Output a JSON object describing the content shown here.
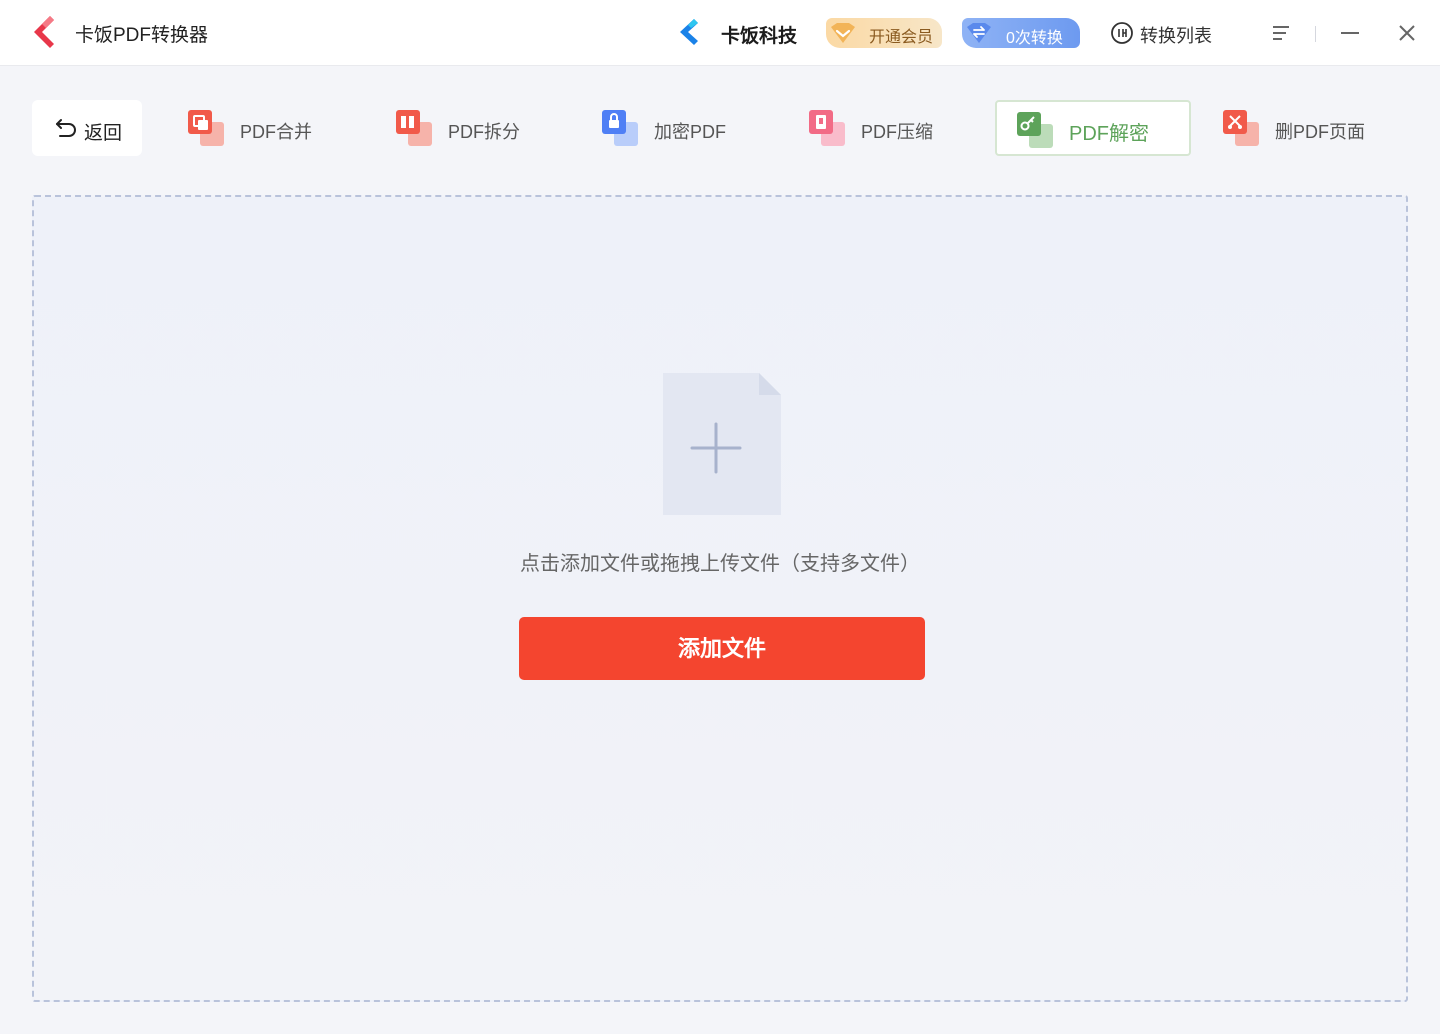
{
  "app": {
    "title": "卡饭PDF转换器"
  },
  "header": {
    "brand_name": "卡饭科技",
    "vip_label": "开通会员",
    "conversion_count_label": "0次转换",
    "conversion_list_label": "转换列表"
  },
  "toolbar": {
    "back_label": "返回",
    "tools": [
      {
        "label": "PDF合并",
        "icon": "pdf-merge-icon",
        "color": "#f15a4a"
      },
      {
        "label": "PDF拆分",
        "icon": "pdf-split-icon",
        "color": "#f15a4a"
      },
      {
        "label": "加密PDF",
        "icon": "pdf-encrypt-icon",
        "color": "#4f7ff5"
      },
      {
        "label": "PDF压缩",
        "icon": "pdf-compress-icon",
        "color": "#f26b86"
      },
      {
        "label": "PDF解密",
        "icon": "pdf-decrypt-icon",
        "color": "#5da35a",
        "active": true
      },
      {
        "label": "删PDF页面",
        "icon": "pdf-delete-page-icon",
        "color": "#f15a4a"
      }
    ]
  },
  "dropzone": {
    "hint": "点击添加文件或拖拽上传文件（支持多文件）",
    "add_button_label": "添加文件"
  },
  "colors": {
    "primary_button": "#f4452f",
    "active_tool": "#5da35a",
    "vip_gold": "#fbd9a4",
    "count_blue": "#6d9af0"
  }
}
